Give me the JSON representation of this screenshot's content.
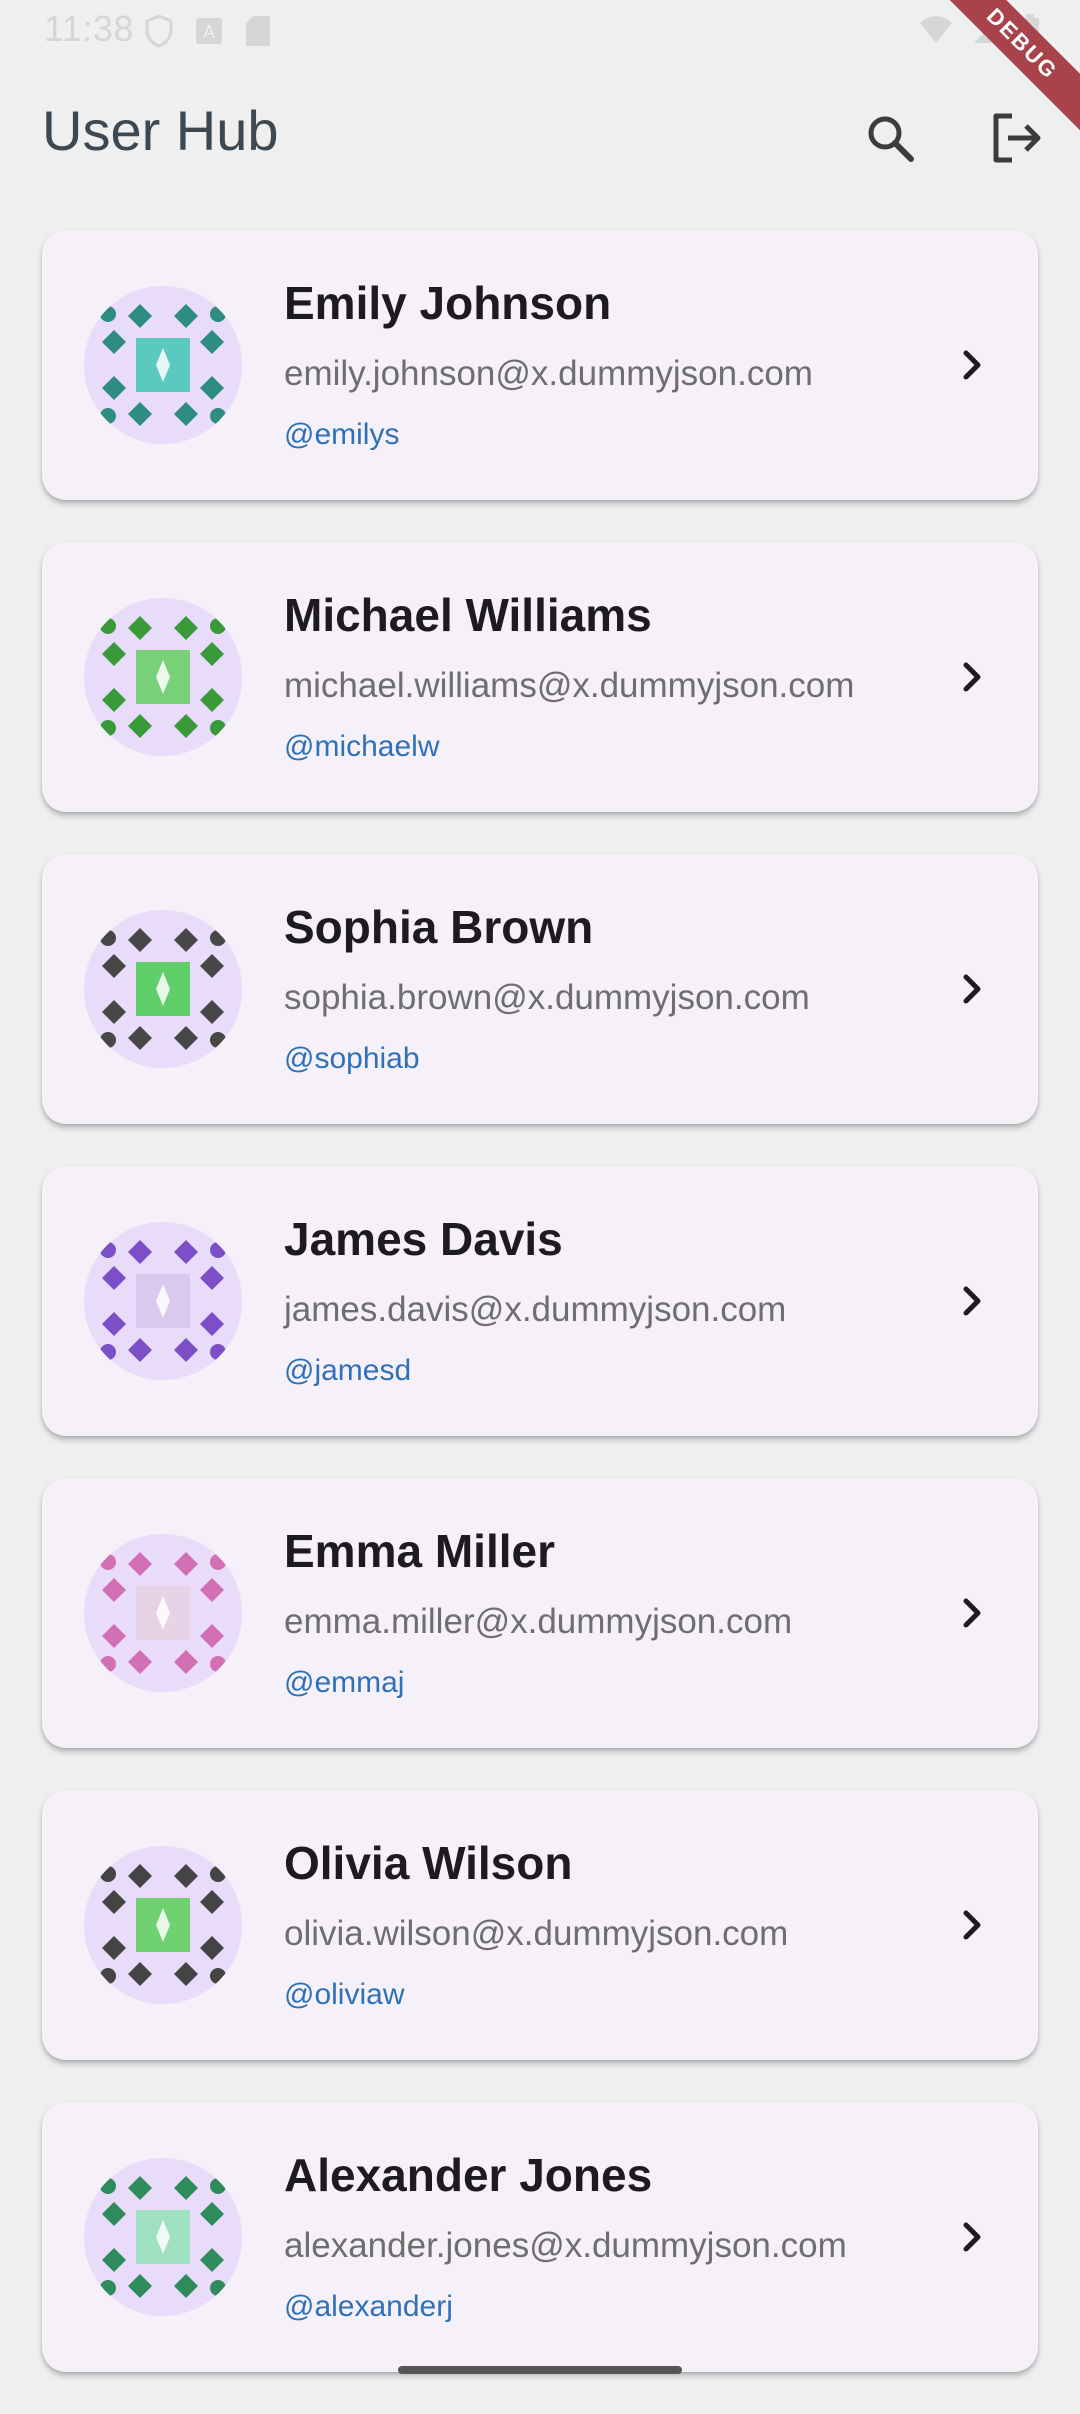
{
  "status_bar": {
    "time": "11:38",
    "debug_label": "DEBUG"
  },
  "app_bar": {
    "title": "User Hub",
    "search_icon": "search-icon",
    "logout_icon": "logout-icon"
  },
  "users": [
    {
      "name": "Emily Johnson",
      "email": "emily.johnson@x.dummyjson.com",
      "handle": "@emilys",
      "avatar_color": "#2f8c80",
      "avatar_accent": "#5bc9bf"
    },
    {
      "name": "Michael Williams",
      "email": "michael.williams@x.dummyjson.com",
      "handle": "@michaelw",
      "avatar_color": "#3a9a3a",
      "avatar_accent": "#78d178"
    },
    {
      "name": "Sophia Brown",
      "email": "sophia.brown@x.dummyjson.com",
      "handle": "@sophiab",
      "avatar_color": "#474747",
      "avatar_accent": "#5fcf6a"
    },
    {
      "name": "James Davis",
      "email": "james.davis@x.dummyjson.com",
      "handle": "@jamesd",
      "avatar_color": "#7c4fc9",
      "avatar_accent": "#d9c9ef"
    },
    {
      "name": "Emma Miller",
      "email": "emma.miller@x.dummyjson.com",
      "handle": "@emmaj",
      "avatar_color": "#d36fb4",
      "avatar_accent": "#e6d3e6"
    },
    {
      "name": "Olivia Wilson",
      "email": "olivia.wilson@x.dummyjson.com",
      "handle": "@oliviaw",
      "avatar_color": "#444444",
      "avatar_accent": "#6fd16f"
    },
    {
      "name": "Alexander Jones",
      "email": "alexander.jones@x.dummyjson.com",
      "handle": "@alexanderj",
      "avatar_color": "#2e8c5c",
      "avatar_accent": "#9fe0c0"
    }
  ],
  "colors": {
    "background": "#efefef",
    "card": "#f6f1f8",
    "avatar_bg": "#e8dcfa",
    "handle": "#2f71b8",
    "title": "#3c4852"
  }
}
